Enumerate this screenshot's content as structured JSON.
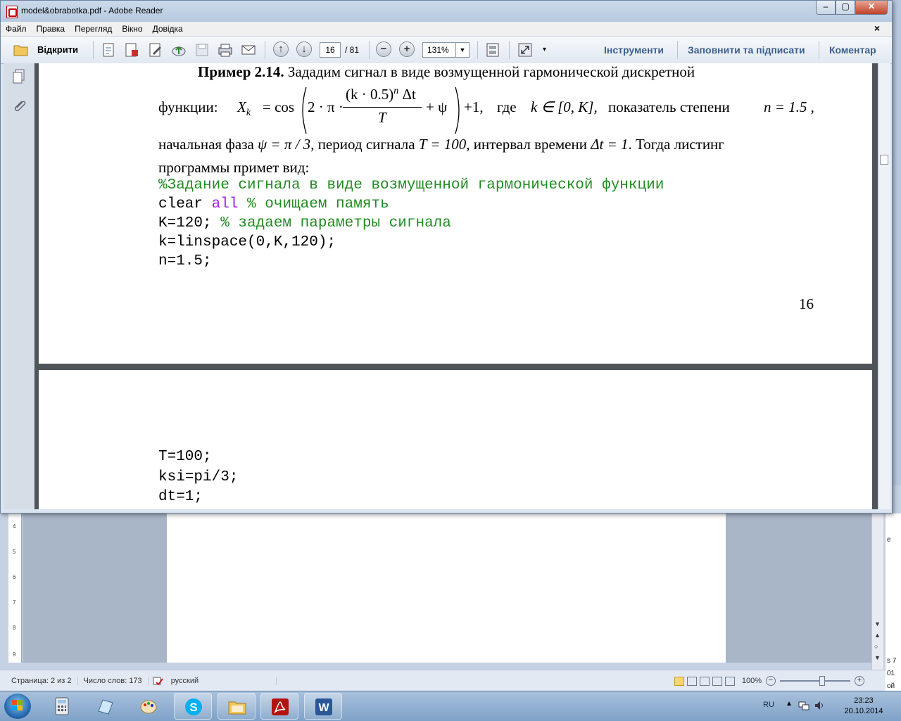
{
  "window": {
    "title": "model&obrabotka.pdf - Adobe Reader",
    "controls": {
      "minimize": "–",
      "maximize": "▢",
      "close": "✕"
    }
  },
  "menu": {
    "items": [
      "Файл",
      "Правка",
      "Перегляд",
      "Вікно",
      "Довідка"
    ],
    "close": "×"
  },
  "toolbar": {
    "open_label": "Відкрити",
    "page_current": "16",
    "page_total": "/ 81",
    "zoom_value": "131%",
    "tools_label": "Інструменти",
    "fill_sign_label": "Заповнити та підписати",
    "comment_label": "Коментар"
  },
  "document": {
    "page1": {
      "example_label": "Пример 2.14.",
      "example_text": " Зададим  сигнал  в  виде  возмущенной  гармонической  дискретной",
      "functions_word": "функции:",
      "formula": {
        "lhs": "X",
        "lhs_sub": "k",
        "equals_cos": " = cos",
        "open": "2 · π ·",
        "numerator": "(k · 0.5)",
        "numerator_sup": "n",
        "numerator_tail": " Δt",
        "denominator": "T",
        "plus_psi": "+ ψ",
        "after": "+1,",
        "where": "где",
        "domain": "k ∈ [0, K],",
        "power_text": "показатель  степени",
        "power_eq": "n = 1.5 ,"
      },
      "line3": {
        "t1": "начальная фаза ",
        "m1": "ψ = π / 3",
        "t2": ", период сигнала ",
        "m2": "T = 100",
        "t3": ", интервал времени ",
        "m3": "Δt = 1",
        "t4": ". Тогда листинг"
      },
      "line4": "программы примет вид:",
      "code": {
        "c1": "%Задание сигнала в виде возмущенной гармонической функции",
        "c2_kw1": "clear ",
        "c2_kw2": "all",
        "c2_cm": " % очищаем память",
        "c3_code": "K=120; ",
        "c3_cm": "% задаем параметры сигнала",
        "c4": "k=linspace(0,K,120);",
        "c5": "n=1.5;"
      },
      "page_number": "16"
    },
    "page2": {
      "code": [
        "T=100;",
        "ksi=pi/3;",
        "dt=1;"
      ]
    }
  },
  "word_status": {
    "page": "Страница: 2 из 2",
    "words": "Число слов: 173",
    "language": "русский",
    "zoom": "100%",
    "zoom_minus": "−",
    "zoom_plus": "+"
  },
  "word_side_fragments": [
    "s 7",
    "01",
    "ой",
    "е"
  ],
  "taskbar": {
    "apps": [
      "calculator-icon",
      "notepad-icon",
      "paint-icon",
      "skype-icon",
      "explorer-icon",
      "acrobat-icon",
      "word-icon"
    ],
    "language": "RU",
    "time": "23:23",
    "date": "20.10.2014"
  },
  "colors": {
    "code_comment": "#228b22",
    "code_keyword": "#a020f0",
    "tool_links": "#3a5f8e"
  }
}
